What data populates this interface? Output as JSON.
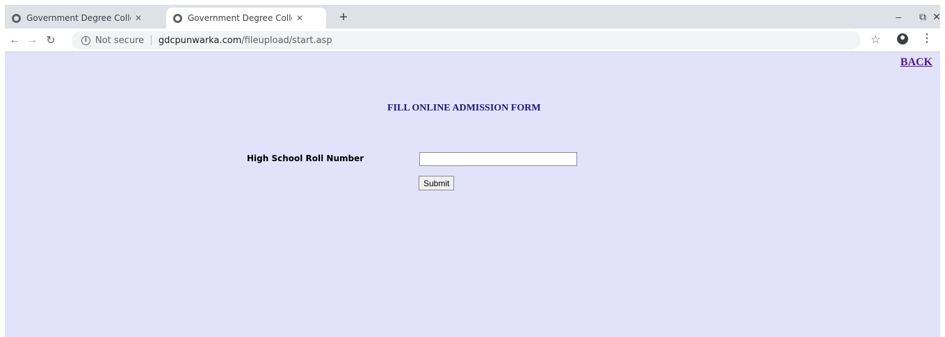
{
  "browser": {
    "tabs": [
      {
        "title": "Government Degree College, Pur",
        "active": false
      },
      {
        "title": "Government Degree College, Pur",
        "active": true
      }
    ],
    "new_tab_symbol": "+",
    "window_controls": {
      "minimize": "–",
      "restore": "⧉",
      "close": "✕"
    },
    "address": {
      "security_text": "Not secure",
      "domain": "gdcpunwarka.com",
      "path": "/fileupload/start.asp"
    },
    "icons": [
      "globe-icon",
      "close-icon",
      "back-arrow-icon",
      "forward-arrow-icon",
      "reload-icon",
      "info-icon",
      "star-icon",
      "account-icon",
      "menu-icon"
    ]
  },
  "page": {
    "back_link": "BACK",
    "title": "FILL ONLINE ADMISSION FORM",
    "form": {
      "roll_label": "High School Roll Number",
      "roll_value": "",
      "submit_label": "Submit"
    },
    "colors": {
      "background": "#e2e2fb",
      "title": "#1a1a7a",
      "link": "#551a8b"
    }
  }
}
